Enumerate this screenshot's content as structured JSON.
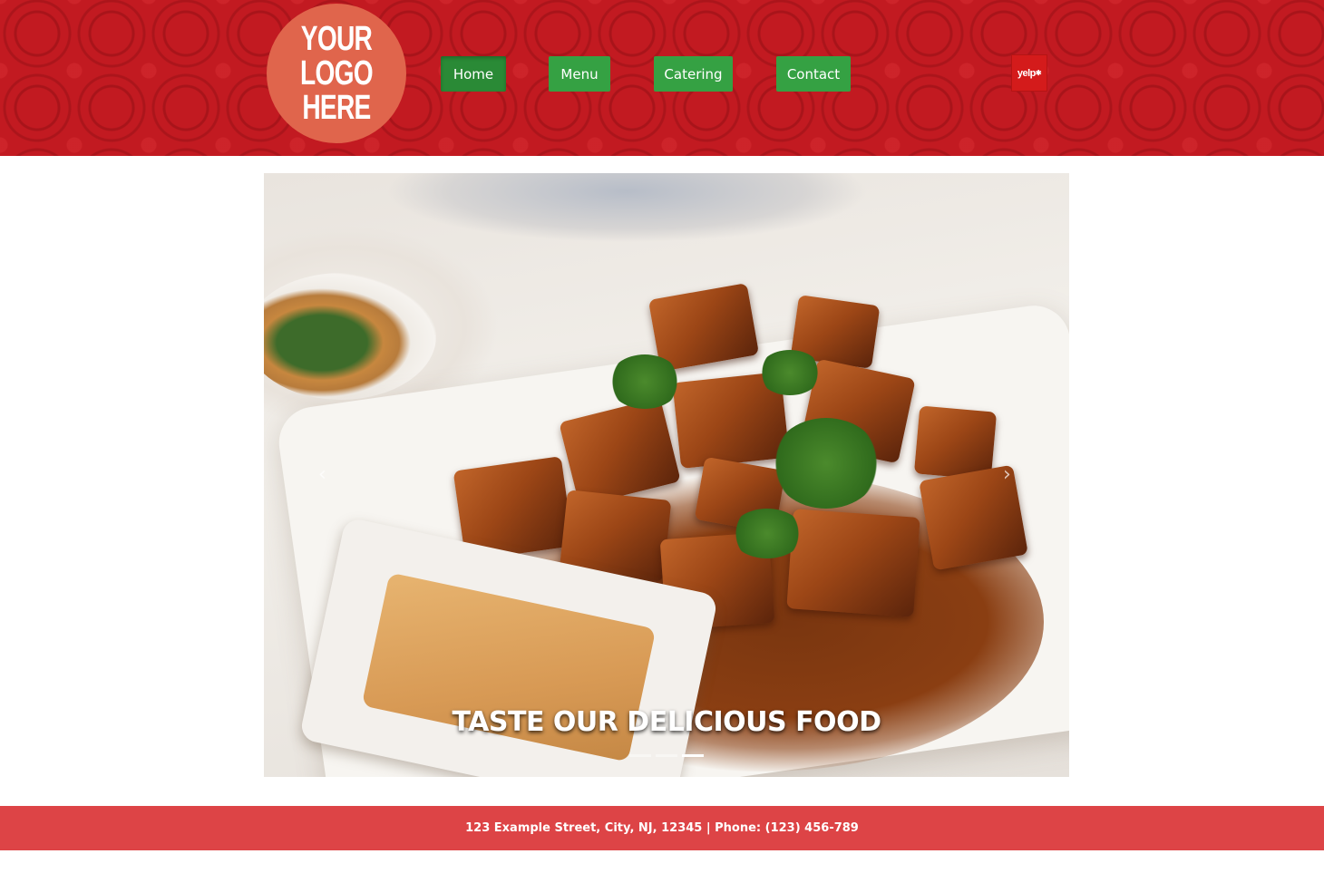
{
  "header": {
    "logo_text": "YOUR\nLOGO\nHERE",
    "nav": [
      {
        "label": "Home",
        "active": true
      },
      {
        "label": "Menu",
        "active": false
      },
      {
        "label": "Catering",
        "active": false
      },
      {
        "label": "Contact",
        "active": false
      }
    ],
    "yelp_label": "yelp",
    "yelp_star": "✱"
  },
  "carousel": {
    "caption": "TASTE OUR DELICIOUS FOOD",
    "prev_arrow": "‹",
    "next_arrow": "›",
    "slide_count": 3,
    "active_slide": 3
  },
  "footer": {
    "text": "123 Example Street, City, NJ, 12345 | Phone: (123) 456-789"
  },
  "colors": {
    "header_red": "#c21a21",
    "logo_circle": "#e0654c",
    "nav_green": "#35a143",
    "footer_red": "#dd4446"
  }
}
